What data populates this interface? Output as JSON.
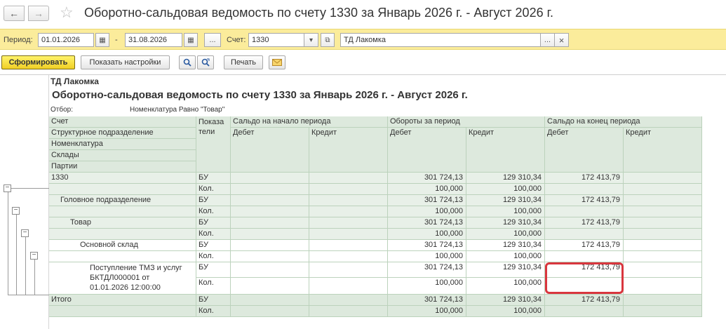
{
  "window": {
    "title": "Оборотно-сальдовая ведомость по счету 1330  за Январь 2026 г. - Август 2026 г.",
    "back_icon": "arrow-left-icon",
    "forward_icon": "arrow-right-icon",
    "favorite_icon": "star-icon"
  },
  "filters": {
    "period_label": "Период:",
    "date_from": "01.01.2026",
    "dash": "-",
    "date_to": "31.08.2026",
    "ellipsis": "...",
    "account_label": "Счет:",
    "account": "1330",
    "org": "ТД Лакомка",
    "clear": "×"
  },
  "toolbar": {
    "generate": "Сформировать",
    "show_settings": "Показать настройки",
    "print": "Печать"
  },
  "report": {
    "org": "ТД Лакомка",
    "title": "Оборотно-сальдовая ведомость по счету 1330  за Январь 2026 г. - Август 2026 г.",
    "filter_label": "Отбор:",
    "filter_value": "Номенклатура Равно \"Товар\"",
    "headers": {
      "account": "Счет",
      "division": "Структурное подразделение",
      "nomenclature": "Номенклатура",
      "warehouses": "Склады",
      "batches": "Партии",
      "indicators": "Показа тели",
      "opening": "Сальдо на начало периода",
      "turnover": "Обороты за период",
      "closing": "Сальдо на конец периода",
      "debit": "Дебет",
      "credit": "Кредит"
    },
    "rows": [
      {
        "name": "1330",
        "bu": "БУ",
        "kol": "Кол.",
        "tdebit": "301 724,13",
        "tcredit": "129 310,34",
        "cdebit": "172 413,79",
        "qdebit": "100,000",
        "qcredit": "100,000"
      },
      {
        "name": "Головное подразделение",
        "bu": "БУ",
        "kol": "Кол.",
        "tdebit": "301 724,13",
        "tcredit": "129 310,34",
        "cdebit": "172 413,79",
        "qdebit": "100,000",
        "qcredit": "100,000"
      },
      {
        "name": "Товар",
        "bu": "БУ",
        "kol": "Кол.",
        "tdebit": "301 724,13",
        "tcredit": "129 310,34",
        "cdebit": "172 413,79",
        "qdebit": "100,000",
        "qcredit": "100,000"
      },
      {
        "name": "Основной склад",
        "bu": "БУ",
        "kol": "Кол.",
        "tdebit": "301 724,13",
        "tcredit": "129 310,34",
        "cdebit": "172 413,79",
        "qdebit": "100,000",
        "qcredit": "100,000"
      },
      {
        "name1": "Поступление ТМЗ и услуг",
        "name2": "БКТДЛ000001 от",
        "name3": "01.01.2026 12:00:00",
        "bu": "БУ",
        "kol": "Кол.",
        "tdebit": "301 724,13",
        "tcredit": "129 310,34",
        "cdebit": "172 413,79",
        "qdebit": "100,000",
        "qcredit": "100,000"
      },
      {
        "name": "Итого",
        "bu": "БУ",
        "kol": "Кол.",
        "tdebit": "301 724,13",
        "tcredit": "129 310,34",
        "cdebit": "172 413,79",
        "qdebit": "100,000",
        "qcredit": "100,000"
      }
    ],
    "tree": {
      "collapse": "−"
    }
  }
}
